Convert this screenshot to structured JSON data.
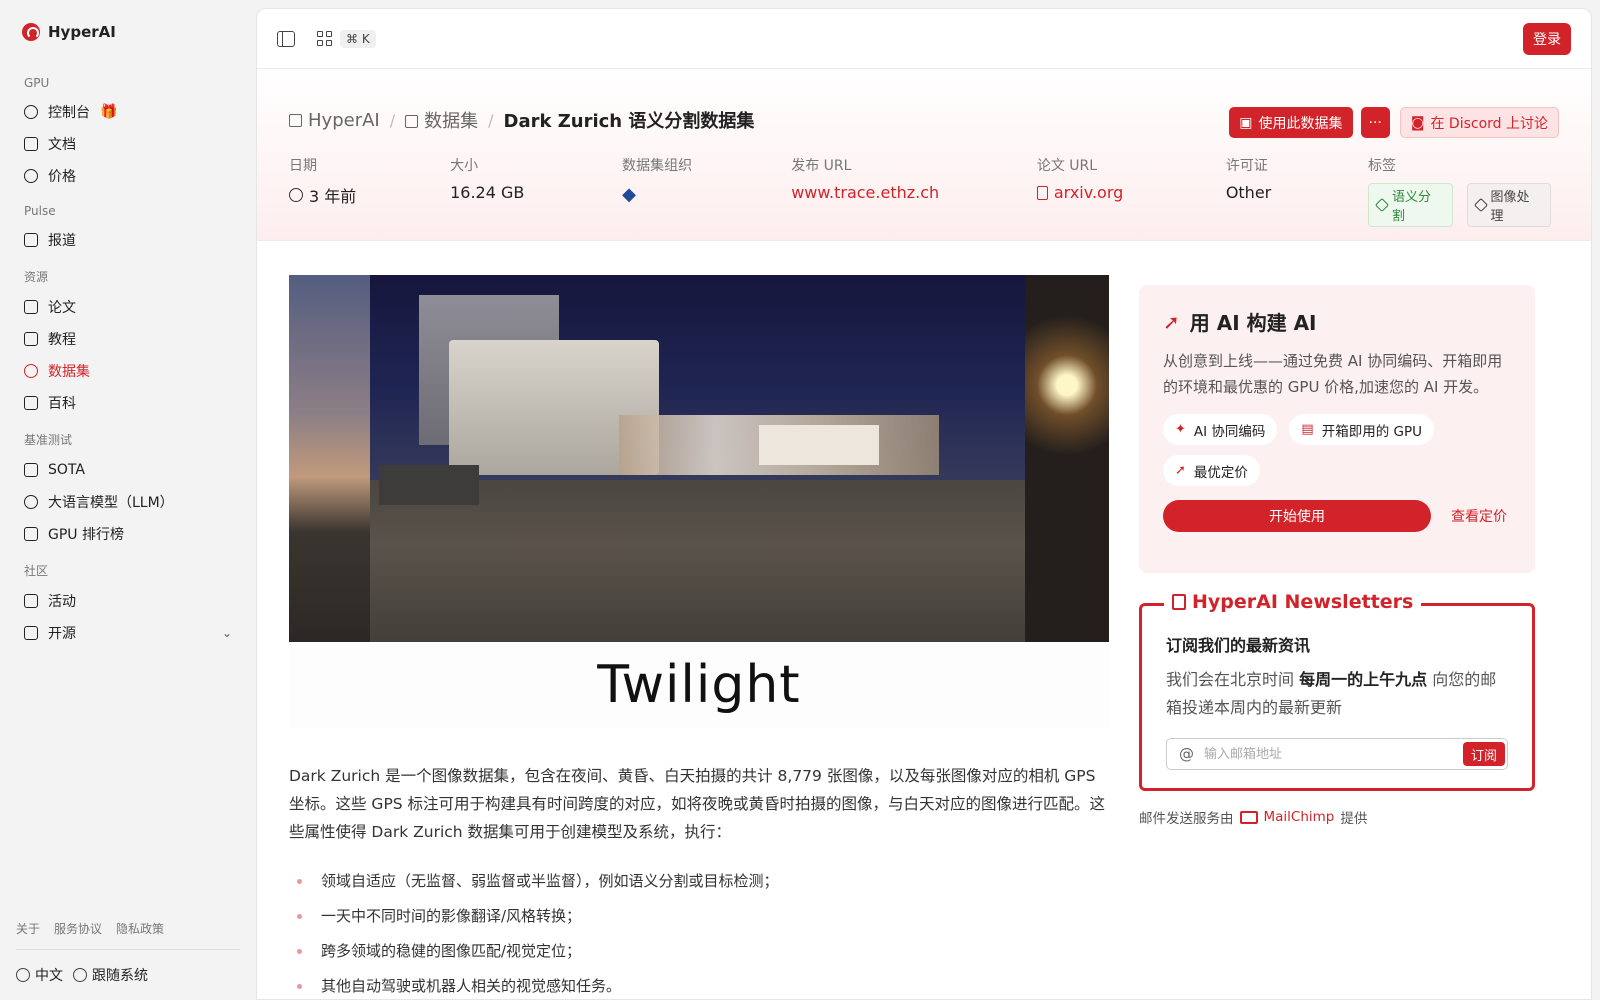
{
  "brand": {
    "name": "HyperAI",
    "accent": "#d2232a"
  },
  "sidebar": {
    "sections": [
      {
        "title": "GPU",
        "items": [
          {
            "label": "控制台",
            "icon": "gauge-icon"
          },
          {
            "label": "文档",
            "icon": "book-icon"
          },
          {
            "label": "价格",
            "icon": "dollar-icon"
          }
        ]
      },
      {
        "title": "Pulse",
        "items": [
          {
            "label": "报道",
            "icon": "newspaper-icon"
          }
        ]
      },
      {
        "title": "资源",
        "items": [
          {
            "label": "论文",
            "icon": "paper-icon"
          },
          {
            "label": "教程",
            "icon": "tutorial-icon"
          },
          {
            "label": "数据集",
            "icon": "database-icon"
          },
          {
            "label": "百科",
            "icon": "encyclopedia-icon"
          }
        ]
      },
      {
        "title": "基准测试",
        "items": [
          {
            "label": "SOTA",
            "icon": "chart-icon"
          },
          {
            "label": "大语言模型（LLM）",
            "icon": "sparkle-icon"
          },
          {
            "label": "GPU 排行榜",
            "icon": "chip-icon"
          }
        ]
      },
      {
        "title": "社区",
        "items": [
          {
            "label": "活动",
            "icon": "calendar-icon"
          },
          {
            "label": "开源",
            "icon": "list-icon"
          }
        ]
      }
    ],
    "footer_links": [
      "关于",
      "服务协议",
      "隐私政策"
    ],
    "language": "中文",
    "theme": "跟随系统"
  },
  "topbar": {
    "shortcut": "⌘ K",
    "login_label": "登录"
  },
  "header": {
    "breadcrumbs": [
      "HyperAI",
      "数据集",
      "Dark Zurich 语义分割数据集"
    ],
    "use_dataset_label": "使用此数据集",
    "more_label": "···",
    "discord_label": "在 Discord 上讨论",
    "meta": [
      {
        "key": "日期",
        "value": "3 年前"
      },
      {
        "key": "大小",
        "value": "16.24 GB"
      },
      {
        "key": "数据集组织",
        "value": ""
      },
      {
        "key": "发布 URL",
        "value": "www.trace.ethz.ch"
      },
      {
        "key": "论文 URL",
        "value": "arxiv.org"
      },
      {
        "key": "许可证",
        "value": "Other"
      },
      {
        "key": "标签",
        "value": ""
      }
    ],
    "tags": [
      "语义分割",
      "图像处理"
    ]
  },
  "content": {
    "image_caption": "Twilight",
    "description": "Dark Zurich 是一个图像数据集，包含在夜间、黄昏、白天拍摄的共计 8,779 张图像，以及每张图像对应的相机 GPS 坐标。这些 GPS 标注可用于构建具有时间跨度的对应，如将夜晚或黄昏时拍摄的图像，与白天对应的图像进行匹配。这些属性使得 Dark Zurich 数据集可用于创建模型及系统，执行：",
    "bullets": [
      "领域自适应（无监督、弱监督或半监督），例如语义分割或目标检测；",
      "一天中不同时间的影像翻译/风格转换；",
      "跨多领域的稳健的图像匹配/视觉定位；",
      "其他自动驾驶或机器人相关的视觉感知任务。"
    ]
  },
  "promo": {
    "title": "用 AI 构建 AI",
    "text": "从创意到上线——通过免费 AI 协同编码、开箱即用的环境和最优惠的 GPU 价格,加速您的 AI 开发。",
    "chips": [
      "AI 协同编码",
      "开箱即用的 GPU",
      "最优定价"
    ],
    "start_label": "开始使用",
    "pricing_label": "查看定价"
  },
  "newsletter": {
    "title": "HyperAI Newsletters",
    "heading": "订阅我们的最新资讯",
    "text_prefix": "我们会在北京时间 ",
    "text_bold": "每周一的上午九点",
    "text_suffix": " 向您的邮箱投递本周内的最新更新",
    "email_placeholder": "输入邮箱地址",
    "subscribe_label": "订阅",
    "provider_prefix": "邮件发送服务由",
    "provider_name": "MailChimp",
    "provider_suffix": "提供"
  }
}
